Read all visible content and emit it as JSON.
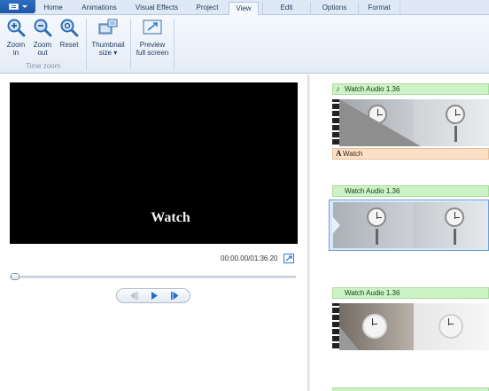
{
  "tabs": [
    {
      "label": "Home",
      "selected": false
    },
    {
      "label": "Animations",
      "selected": false
    },
    {
      "label": "Visual Effects",
      "selected": false
    },
    {
      "label": "Project",
      "selected": false
    },
    {
      "label": "View",
      "selected": true
    },
    {
      "label": "Edit",
      "selected": false
    },
    {
      "label": "Options",
      "selected": false
    },
    {
      "label": "Format",
      "selected": false
    }
  ],
  "ribbon": {
    "zoom_in": {
      "line1": "Zoom",
      "line2": "in"
    },
    "zoom_out": {
      "line1": "Zoom",
      "line2": "out"
    },
    "reset": {
      "line1": "Reset"
    },
    "group_time_zoom": "Time zoom",
    "thumbnail_size": {
      "line1": "Thumbnail",
      "line2": "size ▾"
    },
    "preview_full_screen": {
      "line1": "Preview",
      "line2": "full screen"
    }
  },
  "preview": {
    "caption_text": "Watch",
    "timecode": "00:00.00/01:36.20",
    "seek_position": 0
  },
  "storyboard": {
    "items": [
      {
        "audio_label": "Watch Audio 1.36",
        "has_caption": true,
        "caption_label": "Watch",
        "selected": false
      },
      {
        "audio_label": "Watch Audio 1.36",
        "has_caption": false,
        "selected": true
      },
      {
        "audio_label": "Watch Audio 1.36",
        "has_caption": false,
        "selected": false
      }
    ]
  },
  "colors": {
    "accent": "#2f7ad1",
    "audio_bar": "#cdf2c5",
    "caption_bar": "#fbe0c6",
    "ribbon_bg": "#e4ecf7"
  },
  "icons": {
    "zoom_in": "magnifier-plus-icon",
    "zoom_out": "magnifier-minus-icon",
    "reset": "magnifier-reset-icon",
    "thumbnail": "thumbnail-size-icon",
    "preview_full": "full-screen-icon",
    "prev_frame": "previous-frame-icon",
    "play": "play-icon",
    "next_frame": "next-frame-icon",
    "audio": "music-note-icon",
    "caption": "caption-icon"
  }
}
